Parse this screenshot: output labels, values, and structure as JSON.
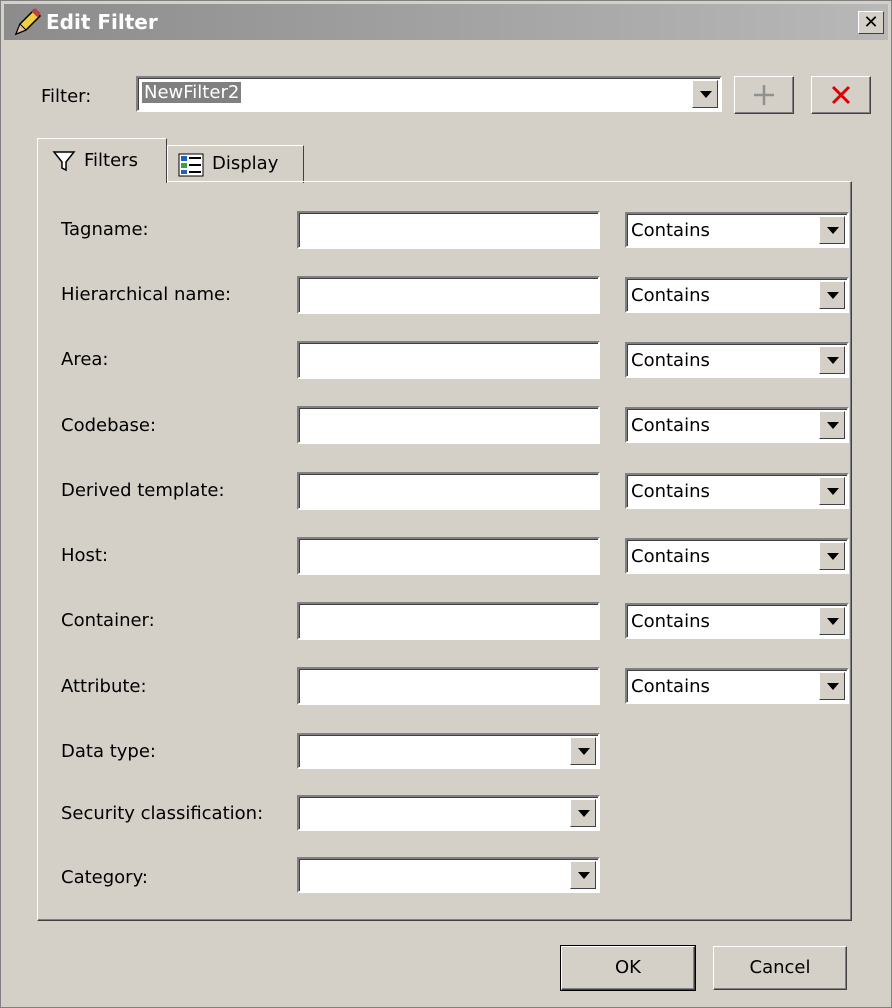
{
  "window": {
    "title": "Edit Filter",
    "close_label": "✕"
  },
  "filter": {
    "label": "Filter:",
    "value": "NewFilter2"
  },
  "tabs": [
    {
      "label": "Filters"
    },
    {
      "label": "Display"
    }
  ],
  "fields": [
    {
      "label": "Tagname:",
      "op": "Contains"
    },
    {
      "label": "Hierarchical name:",
      "op": "Contains"
    },
    {
      "label": "Area:",
      "op": "Contains"
    },
    {
      "label": "Codebase:",
      "op": "Contains"
    },
    {
      "label": "Derived template:",
      "op": "Contains"
    },
    {
      "label": "Host:",
      "op": "Contains"
    },
    {
      "label": "Container:",
      "op": "Contains"
    },
    {
      "label": "Attribute:",
      "op": "Contains"
    }
  ],
  "selects": [
    {
      "label": "Data type:"
    },
    {
      "label": "Security classification:"
    },
    {
      "label": "Category:"
    }
  ],
  "buttons": {
    "ok": "OK",
    "cancel": "Cancel"
  }
}
